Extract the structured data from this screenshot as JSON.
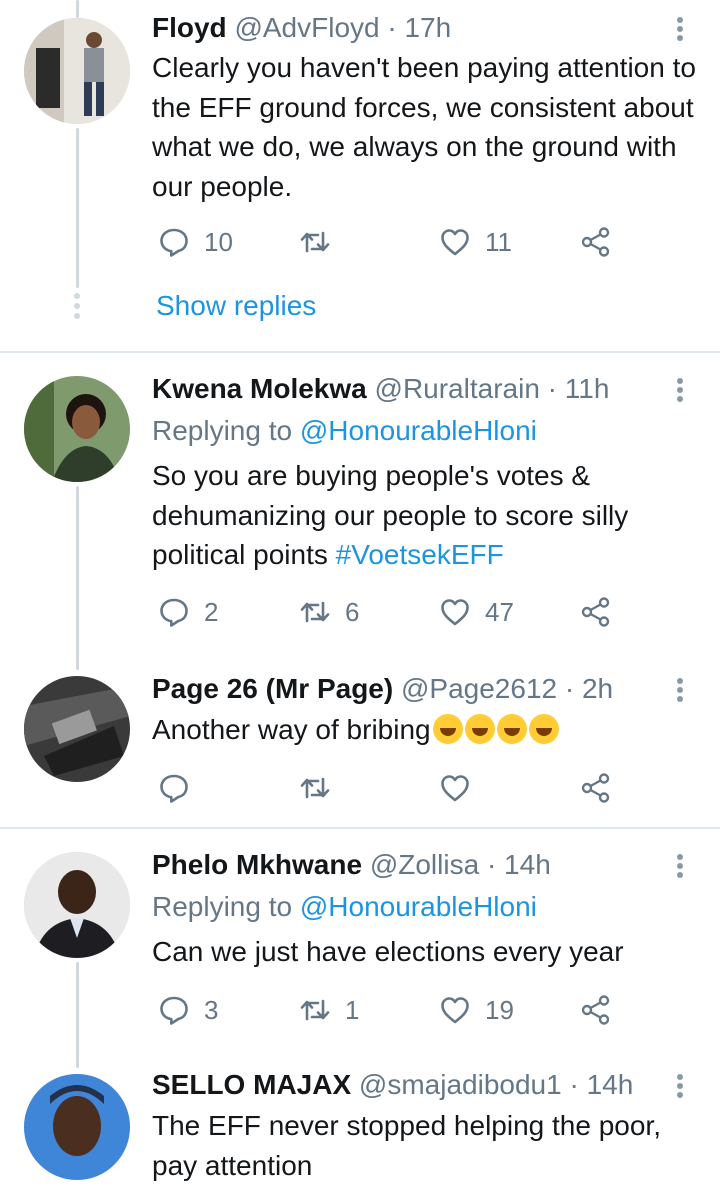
{
  "tweets": [
    {
      "name": "Floyd",
      "handle": "@AdvFloyd",
      "time": "· 17h",
      "text": "Clearly you haven't been paying attention to the EFF ground forces, we consistent about what we do, we always on the ground with our people.",
      "replies": "10",
      "retweets": "",
      "likes": "11",
      "show_replies": "Show replies"
    },
    {
      "name": "Kwena Molekwa",
      "handle": "@Ruraltarain",
      "time": "· 11h",
      "replying_prefix": "Replying to",
      "replying_to": "@HonourableHloni",
      "text": "So you are buying people's votes & dehumanizing our people to score silly political points",
      "hashtag": "#VoetsekEFF",
      "replies": "2",
      "retweets": "6",
      "likes": "47"
    },
    {
      "name": "Page 26 (Mr Page)",
      "handle": "@Page2612",
      "time": "· 2h",
      "text": "Another way of bribing",
      "emoji": "rolling-on-floor-laughing-emoji",
      "replies": "",
      "retweets": "",
      "likes": ""
    },
    {
      "name": "Phelo Mkhwane",
      "handle": "@Zollisa",
      "time": "· 14h",
      "replying_prefix": "Replying to",
      "replying_to": "@HonourableHloni",
      "text": "Can we just have elections every year",
      "replies": "3",
      "retweets": "1",
      "likes": "19"
    },
    {
      "name": "SELLO MAJAX",
      "handle": "@smajadibodu1",
      "time": "· 14h",
      "text": "The EFF never stopped helping the poor, pay attention"
    }
  ],
  "icons": {
    "reply": "reply-icon",
    "retweet": "retweet-icon",
    "like": "heart-icon",
    "share": "share-icon",
    "more": "more-vertical-icon"
  },
  "colors": {
    "link": "#1b95e0",
    "secondary": "#657786",
    "thread": "#cfd9de",
    "divider": "#e1e8ed"
  }
}
